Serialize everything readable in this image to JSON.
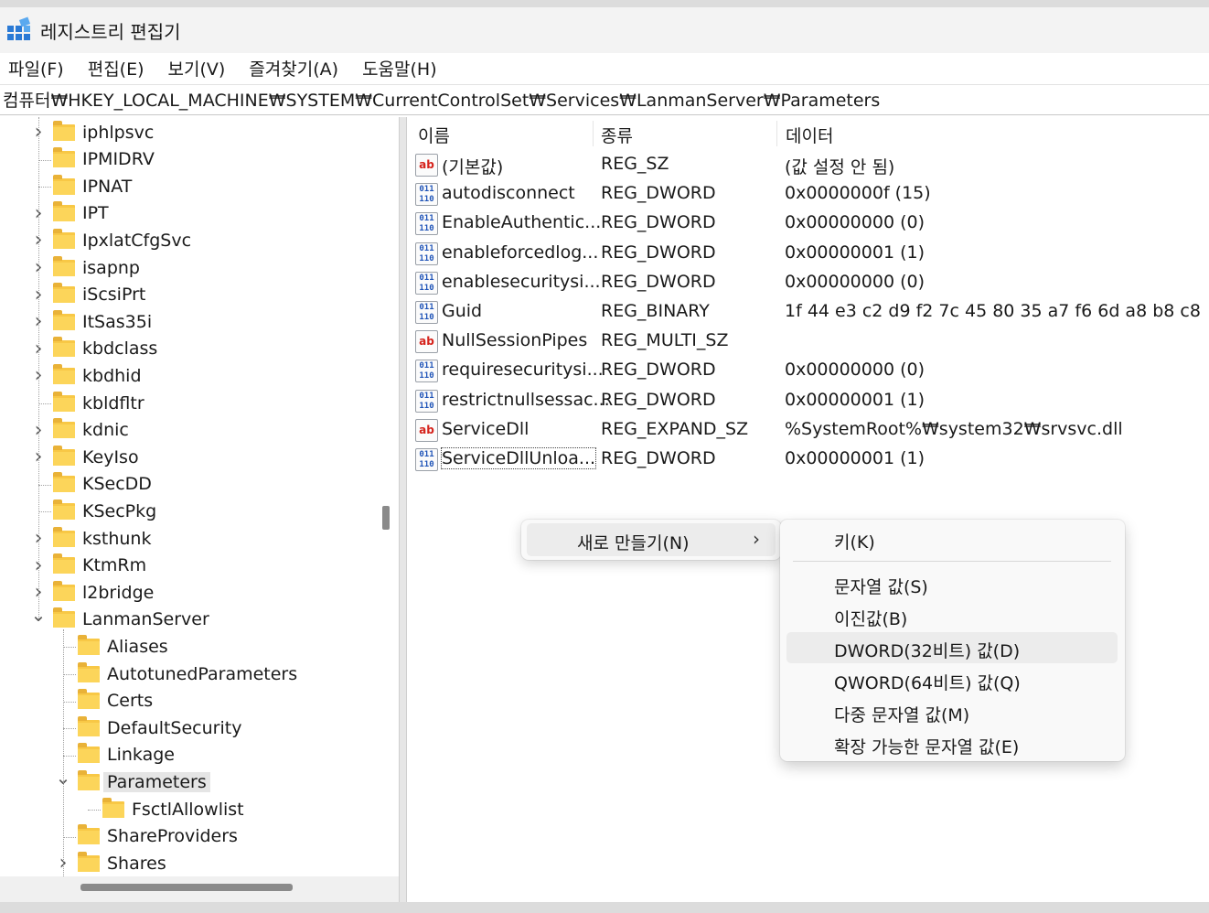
{
  "window": {
    "title": "레지스트리 편집기",
    "icon": "registry-editor-icon"
  },
  "menubar": {
    "items": [
      "파일(F)",
      "편집(E)",
      "보기(V)",
      "즐겨찾기(A)",
      "도움말(H)"
    ]
  },
  "address": {
    "path": "컴퓨터₩HKEY_LOCAL_MACHINE₩SYSTEM₩CurrentControlSet₩Services₩LanmanServer₩Parameters"
  },
  "tree": {
    "items": [
      {
        "label": "iphlpsvc",
        "depth": 0,
        "expander": "collapsed"
      },
      {
        "label": "IPMIDRV",
        "depth": 0,
        "expander": "none"
      },
      {
        "label": "IPNAT",
        "depth": 0,
        "expander": "none"
      },
      {
        "label": "IPT",
        "depth": 0,
        "expander": "collapsed"
      },
      {
        "label": "IpxlatCfgSvc",
        "depth": 0,
        "expander": "collapsed"
      },
      {
        "label": "isapnp",
        "depth": 0,
        "expander": "collapsed"
      },
      {
        "label": "iScsiPrt",
        "depth": 0,
        "expander": "collapsed"
      },
      {
        "label": "ItSas35i",
        "depth": 0,
        "expander": "collapsed"
      },
      {
        "label": "kbdclass",
        "depth": 0,
        "expander": "collapsed"
      },
      {
        "label": "kbdhid",
        "depth": 0,
        "expander": "collapsed"
      },
      {
        "label": "kbldfltr",
        "depth": 0,
        "expander": "none"
      },
      {
        "label": "kdnic",
        "depth": 0,
        "expander": "collapsed"
      },
      {
        "label": "KeyIso",
        "depth": 0,
        "expander": "collapsed"
      },
      {
        "label": "KSecDD",
        "depth": 0,
        "expander": "none"
      },
      {
        "label": "KSecPkg",
        "depth": 0,
        "expander": "none"
      },
      {
        "label": "ksthunk",
        "depth": 0,
        "expander": "collapsed"
      },
      {
        "label": "KtmRm",
        "depth": 0,
        "expander": "collapsed"
      },
      {
        "label": "l2bridge",
        "depth": 0,
        "expander": "collapsed"
      },
      {
        "label": "LanmanServer",
        "depth": 0,
        "expander": "expanded"
      },
      {
        "label": "Aliases",
        "depth": 1,
        "expander": "none"
      },
      {
        "label": "AutotunedParameters",
        "depth": 1,
        "expander": "none"
      },
      {
        "label": "Certs",
        "depth": 1,
        "expander": "none"
      },
      {
        "label": "DefaultSecurity",
        "depth": 1,
        "expander": "none"
      },
      {
        "label": "Linkage",
        "depth": 1,
        "expander": "none"
      },
      {
        "label": "Parameters",
        "depth": 1,
        "expander": "expanded",
        "selected": true
      },
      {
        "label": "FsctlAllowlist",
        "depth": 2,
        "expander": "none"
      },
      {
        "label": "ShareProviders",
        "depth": 1,
        "expander": "none"
      },
      {
        "label": "Shares",
        "depth": 1,
        "expander": "collapsed"
      }
    ]
  },
  "list": {
    "columns": [
      "이름",
      "종류",
      "데이터"
    ],
    "rows": [
      {
        "icon": "string",
        "name": "(기본값)",
        "type": "REG_SZ",
        "data": "(값 설정 안 됨)"
      },
      {
        "icon": "binary",
        "name": "autodisconnect",
        "type": "REG_DWORD",
        "data": "0x0000000f (15)"
      },
      {
        "icon": "binary",
        "name": "EnableAuthentic...",
        "type": "REG_DWORD",
        "data": "0x00000000 (0)"
      },
      {
        "icon": "binary",
        "name": "enableforcedlog...",
        "type": "REG_DWORD",
        "data": "0x00000001 (1)"
      },
      {
        "icon": "binary",
        "name": "enablesecuritysi...",
        "type": "REG_DWORD",
        "data": "0x00000000 (0)"
      },
      {
        "icon": "binary",
        "name": "Guid",
        "type": "REG_BINARY",
        "data": "1f 44 e3 c2 d9 f2 7c 45 80 35 a7 f6 6d a8 b8 c8"
      },
      {
        "icon": "string",
        "name": "NullSessionPipes",
        "type": "REG_MULTI_SZ",
        "data": ""
      },
      {
        "icon": "binary",
        "name": "requiresecuritysi...",
        "type": "REG_DWORD",
        "data": "0x00000000 (0)"
      },
      {
        "icon": "binary",
        "name": "restrictnullsessac...",
        "type": "REG_DWORD",
        "data": "0x00000001 (1)"
      },
      {
        "icon": "string",
        "name": "ServiceDll",
        "type": "REG_EXPAND_SZ",
        "data": "%SystemRoot%₩system32₩srvsvc.dll"
      },
      {
        "icon": "binary",
        "name": "ServiceDllUnloa...",
        "type": "REG_DWORD",
        "data": "0x00000001 (1)",
        "focused": true
      }
    ]
  },
  "context_menu": {
    "item": {
      "label": "새로 만들기(N)",
      "arrow": "›"
    },
    "submenu": [
      {
        "label": "키(K)"
      },
      {
        "separator": true
      },
      {
        "label": "문자열 값(S)"
      },
      {
        "label": "이진값(B)"
      },
      {
        "label": "DWORD(32비트) 값(D)",
        "hover": true
      },
      {
        "label": "QWORD(64비트) 값(Q)"
      },
      {
        "label": "다중 문자열 값(M)"
      },
      {
        "label": "확장 가능한 문자열 값(E)"
      }
    ]
  },
  "icon_glyphs": {
    "string": "ab",
    "binary": "011\n110"
  },
  "colors": {
    "accent": "#2a7ad5",
    "folder": "#f8c846",
    "hover": "#ececec",
    "string_icon": "#d5221b",
    "binary_icon": "#1f54b8"
  }
}
